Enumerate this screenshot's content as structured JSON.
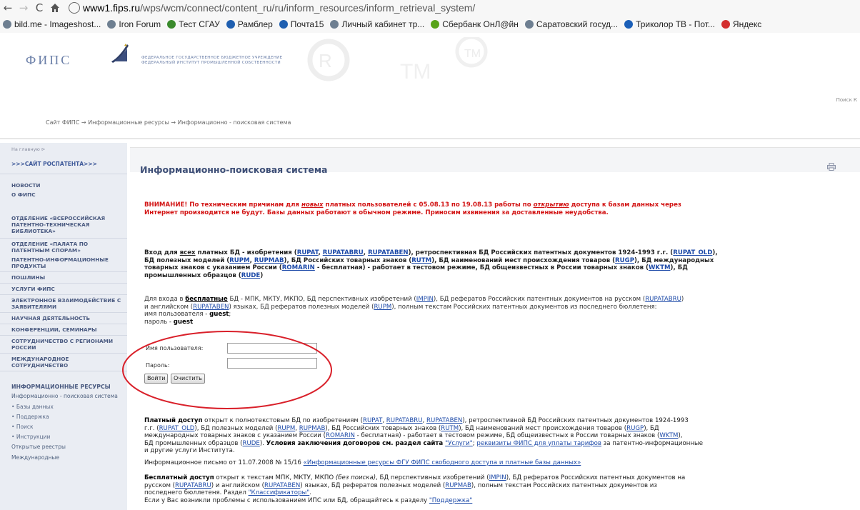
{
  "browser": {
    "url_host": "www1.fips.ru",
    "url_path": "/wps/wcm/connect/content_ru/ru/inform_resources/inform_retrieval_system/",
    "bookmarks": [
      {
        "label": "bild.me - Imageshost...",
        "color": "#6e7f91"
      },
      {
        "label": "Iron Forum",
        "color": "#6e7f91"
      },
      {
        "label": "Тест СГАУ",
        "color": "#3a8a2c"
      },
      {
        "label": "Рамблер",
        "color": "#1f5fb0"
      },
      {
        "label": "Почта15",
        "color": "#1f5fb0"
      },
      {
        "label": "Личный кабинет тр...",
        "color": "#6e7f91"
      },
      {
        "label": "Сбербанк ОнЛ@йн",
        "color": "#57a318"
      },
      {
        "label": "Саратовский госуд...",
        "color": "#6e7f91"
      },
      {
        "label": "Триколор ТВ - Пот...",
        "color": "#1b5fb8"
      },
      {
        "label": "Яндекс",
        "color": "#d32f2f"
      }
    ]
  },
  "header": {
    "logo": "ФИПС",
    "org_line1": "ФЕДЕРАЛЬНОЕ ГОСУДАРСТВЕННОЕ БЮДЖЕТНОЕ УЧРЕЖДЕНИЕ",
    "org_line2": "ФЕДЕРАЛЬНЫЙ ИНСТИТУТ ПРОМЫШЛЕННОЙ СОБСТВЕННОСТИ",
    "search": "Поиск К"
  },
  "breadcrumb": "Сайт ФИПС → Информационные ресурсы → Информационно - поисковая система",
  "sidebar": {
    "crumb": "На главную  ⊳",
    "items": [
      {
        "label": ">>>САЙТ РОСПАТЕНТА>>>"
      },
      {
        "label": "НОВОСТИ"
      },
      {
        "label": "О ФИПС"
      },
      {
        "label": "ОТДЕЛЕНИЕ «ВСЕРОССИЙСКАЯ ПАТЕНТНО-ТЕХНИЧЕСКАЯ БИБЛИОТЕКА»"
      },
      {
        "label": "ОТДЕЛЕНИЕ «ПАЛАТА ПО ПАТЕНТНЫМ СПОРАМ»"
      },
      {
        "label": "ПАТЕНТНО-ИНФОРМАЦИОННЫЕ ПРОДУКТЫ"
      },
      {
        "label": "ПОШЛИНЫ"
      },
      {
        "label": "УСЛУГИ ФИПС"
      },
      {
        "label": "ЭЛЕКТРОННОЕ ВЗАИМОДЕЙСТВИЕ С ЗАЯВИТЕЛЯМИ"
      },
      {
        "label": "НАУЧНАЯ ДЕЯТЕЛЬНОСТЬ"
      },
      {
        "label": "КОНФЕРЕНЦИИ, СЕМИНАРЫ"
      },
      {
        "label": "СОТРУДНИЧЕСТВО С РЕГИОНАМИ РОССИИ"
      },
      {
        "label": "МЕЖДУНАРОДНОЕ СОТРУДНИЧЕСТВО"
      },
      {
        "label": "ИНФОРМАЦИОННЫЕ РЕСУРСЫ"
      }
    ],
    "sub_active": "Информационно - поисковая система",
    "bullets": [
      "Базы данных",
      "Поддержка",
      "Поиск",
      "Инструкции"
    ],
    "sub_after": [
      "Открытые реестры",
      "Международные"
    ]
  },
  "main": {
    "title": "Информационно-поисковая система",
    "warning": {
      "pre": "ВНИМАНИЕ! По техническим причинам для ",
      "em1": "новых",
      "mid": " платных пользователей с 05.08.13 по 19.08.13 работы по ",
      "em2": "открытию",
      "post": " доступа к базам данных через",
      "line2": "Интернет производится не будут. Базы данных работают в обычном режиме. Приносим извинения за доставленные неудобства."
    },
    "paid_login": {
      "l1_pre": "Вход для ",
      "l1_all": "всех",
      "l1_mid": " платных БД - изобретения (",
      "lk_rupat": "RUPAT",
      "lk_rupatabru": "RUPATABRU",
      "lk_rupataben": "RUPATABEN",
      "l1_retro": "), ретроспективная БД Российских патентных документов 1924-1993 г.г. (",
      "lk_rupat_old": "RUPAT_OLD",
      "l1_end": "),",
      "l2_pre": "БД полезных моделей (",
      "lk_rupm": "RUPM",
      "lk_rupmab": "RUPMAB",
      "l2_tm": "), БД Российских товарных знаков (",
      "lk_rutm": "RUTM",
      "l2_ugp": "), БД наименований мест происхождения товаров (",
      "lk_rugp": "RUGP",
      "l2_end": "), БД международных",
      "l3_pre": "товарных знаков с указанием России (",
      "lk_romarin": "ROMARIN",
      "l3_mid": " - бесплатная) - работает в тестовом режиме, БД общеизвестных в России товарных знаков (",
      "lk_wktm": "WKTM",
      "l3_end": "), БД",
      "l4_pre": "промышленных образцов (",
      "lk_rude": "RUDE",
      "l4_end": ")"
    },
    "free_login": {
      "l1_pre": "Для входа в ",
      "l1_free": "бесплатные",
      "l1_mid": " БД - МПК, МКТУ, МКПО, БД перспективных изобретений (",
      "lk_impin": "IMPIN",
      "l1_mid2": "), БД рефератов Российских патентных документов на русском (",
      "lk_rupatabru": "RUPATABRU",
      "l1_end": ")",
      "l2_pre": "и английском (",
      "lk_rupataben": "RUPATABEN",
      "l2_mid": ") языках, БД рефератов полезных моделей (",
      "lk_rupm": "RUPM",
      "l2_end": "), полным текстам Российских патентных документов из последнего бюллетеня:",
      "user_label": "имя пользователя - ",
      "user_value": "guest",
      "pass_label": "пароль  - ",
      "pass_value": "guest"
    },
    "login_form": {
      "username_label": "Имя пользователя:",
      "password_label": "Пароль:",
      "username_value": "",
      "password_value": "",
      "login_button": "Войти",
      "clear_button": "Очистить"
    },
    "paid_access": {
      "l1_bold": "Платный доступ",
      "l1_mid": " открыт к полнотекстовым БД по изобретениям (",
      "lk_rupat": "RUPAT",
      "lk_rupatabru": "RUPATABRU",
      "lk_rupataben": "RUPATABEN",
      "l1_end": "), ретроспективной БД Российских патентных документов 1924-1993",
      "l2_pre": "г.г. (",
      "lk_rupat_old": "RUPAT_OLD",
      "l2_mid": "), БД полезных моделей (",
      "lk_rupm": "RUPM",
      "lk_rupmab": "RUPMAB",
      "l2_tm": "), БД Российских товарных знаков (",
      "lk_rutm": "RUTM",
      "l2_ugp": "),  БД наименований мест происхождения товаров (",
      "lk_rugp": "RUGP",
      "l2_end": "), БД",
      "l3_pre": "международных товарных знаков с указанием России (",
      "lk_romarin": "ROMARIN",
      "l3_mid": " - бесплатная) - работает в тестовом режиме, БД общеизвестных в России товарных знаков (",
      "lk_wktm": "WKTM",
      "l3_end": "),",
      "l4_pre": "БД промышленных образцов (",
      "lk_rude": "RUDE",
      "l4_mid": "). ",
      "l4_bold": "Условия заключения договоров см. раздел сайта ",
      "lk_uslugi": "\"Услуги\"",
      "l4_sep": "; ",
      "lk_rekv": "реквизиты ФИПС для уплаты тарифов",
      "l4_end": " за патентно-информационные",
      "l5": "и другие услуги Института."
    },
    "info_letter": {
      "pre": "Информационное письмо от 11.07.2008 № 15/16 ",
      "link": "«Информационные ресурсы ФГУ ФИПС свободного доступа и платные базы данных»"
    },
    "free_access": {
      "l1_bold": "Бесплатный доступ",
      "l1_mid": " открыт к текстам МПК, МКТУ, МКПО ",
      "l1_em": "(без поиска)",
      "l1_mid2": ", БД перспективных изобретений (",
      "lk_impin": "IMPIN",
      "l1_mid3": "), БД рефератов Российских патентных документов на",
      "l2_pre": "русском (",
      "lk_rupatabru": "RUPATABRU",
      "l2_mid": ") и английском (",
      "lk_rupataben": "RUPATABEN",
      "l2_mid2": ") языках, БД рефератов полезных моделей (",
      "lk_rupmab": "RUPMAB",
      "l2_end": "), полным текстам Российских патентных документов из",
      "l3_pre": "последнего бюллетеня. Раздел ",
      "lk_class": "\"Классификаторы\"",
      "l3_end": ".",
      "l4_pre": "Если у Вас возникли проблемы с использованием ИПС или БД, обращайтесь к разделу ",
      "lk_support": "\"Поддержка\""
    }
  },
  "colors": {
    "annotation": "#d9202a",
    "link": "#1d4aa8",
    "warning": "#d21414",
    "title": "#3e4f77"
  }
}
